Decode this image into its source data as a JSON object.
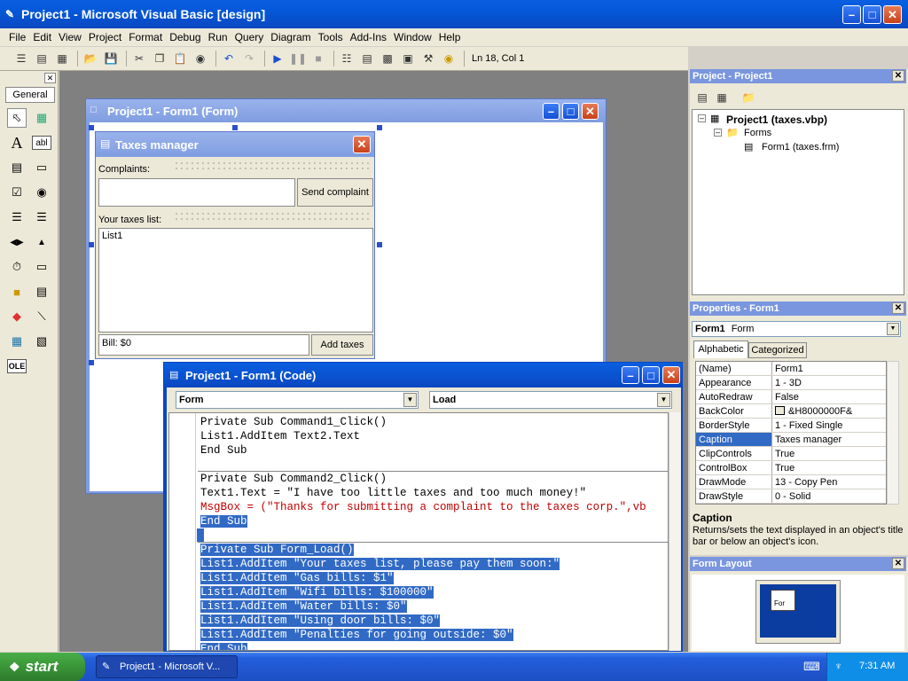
{
  "app": {
    "title": "Project1 - Microsoft Visual Basic [design]"
  },
  "menu": [
    "File",
    "Edit",
    "View",
    "Project",
    "Format",
    "Debug",
    "Run",
    "Query",
    "Diagram",
    "Tools",
    "Add-Ins",
    "Window",
    "Help"
  ],
  "toolbar": {
    "position": "Ln 18, Col 1"
  },
  "toolbox": {
    "tab": "General"
  },
  "form_designer": {
    "title": "Project1 - Form1 (Form)",
    "form_caption": "Taxes manager",
    "complaints_label": "Complaints:",
    "send_button": "Send complaint",
    "taxes_label": "Your taxes list:",
    "list_default": "List1",
    "bill_label": "Bill: $0",
    "add_button": "Add taxes"
  },
  "code_window": {
    "title": "Project1 - Form1 (Code)",
    "object_combo": "Form",
    "proc_combo": "Load",
    "lines": [
      {
        "text": "Private Sub Command1_Click()",
        "style": "normal"
      },
      {
        "text": "List1.AddItem Text2.Text",
        "style": "normal"
      },
      {
        "text": "End Sub",
        "style": "normal"
      },
      {
        "text": "",
        "style": "divider"
      },
      {
        "text": "Private Sub Command2_Click()",
        "style": "normal"
      },
      {
        "text": "Text1.Text = \"I have too little taxes and too much money!\"",
        "style": "normal"
      },
      {
        "text": "MsgBox = (\"Thanks for submitting a complaint to the taxes corp.\",vb",
        "style": "error"
      },
      {
        "text": "End Sub",
        "style": "selected"
      },
      {
        "text": "",
        "style": "selected-divider"
      },
      {
        "text": "Private Sub Form_Load()",
        "style": "selected"
      },
      {
        "text": "List1.AddItem \"Your taxes list, please pay them soon:\"",
        "style": "selected"
      },
      {
        "text": "List1.AddItem \"Gas bills: $1\"",
        "style": "selected"
      },
      {
        "text": "List1.AddItem \"Wifi bills: $100000\"",
        "style": "selected"
      },
      {
        "text": "List1.AddItem \"Water bills: $0\"",
        "style": "selected"
      },
      {
        "text": "List1.AddItem \"Using door bills: $0\"",
        "style": "selected"
      },
      {
        "text": "List1.AddItem \"Penalties for going outside: $0\"",
        "style": "selected"
      },
      {
        "text": "End Sub",
        "style": "selected"
      }
    ]
  },
  "project_panel": {
    "title": "Project - Project1",
    "root": "Project1 (taxes.vbp)",
    "folder": "Forms",
    "file": "Form1 (taxes.frm)"
  },
  "properties_panel": {
    "title": "Properties - Form1",
    "object": "Form1",
    "object_type": "Form",
    "tab_alpha": "Alphabetic",
    "tab_cat": "Categorized",
    "rows": [
      {
        "k": "(Name)",
        "v": "Form1"
      },
      {
        "k": "Appearance",
        "v": "1 - 3D"
      },
      {
        "k": "AutoRedraw",
        "v": "False"
      },
      {
        "k": "BackColor",
        "v": "&H8000000F&"
      },
      {
        "k": "BorderStyle",
        "v": "1 - Fixed Single"
      },
      {
        "k": "Caption",
        "v": "Taxes manager"
      },
      {
        "k": "ClipControls",
        "v": "True"
      },
      {
        "k": "ControlBox",
        "v": "True"
      },
      {
        "k": "DrawMode",
        "v": "13 - Copy Pen"
      },
      {
        "k": "DrawStyle",
        "v": "0 - Solid"
      }
    ],
    "desc_title": "Caption",
    "desc_text": "Returns/sets the text displayed in an object's title bar or below an object's icon."
  },
  "form_layout": {
    "title": "Form Layout",
    "mini_label": "For"
  },
  "taskbar": {
    "start": "start",
    "task": "Project1 - Microsoft V...",
    "clock": "7:31 AM"
  },
  "colors": {
    "title_blue": "#0a5fe0",
    "selection": "#316ac5",
    "error_red": "#c00000",
    "taskbar": "#245edb",
    "start_green": "#3c9a3a"
  }
}
